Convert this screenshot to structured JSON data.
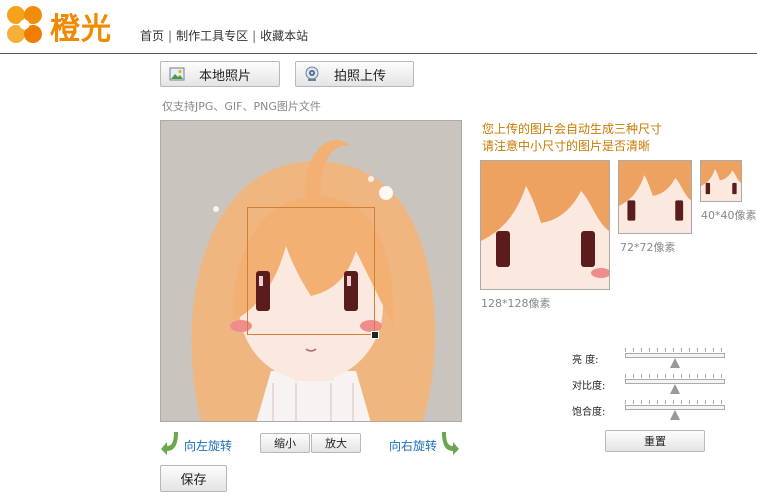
{
  "header": {
    "logo_text": "橙光",
    "nav": [
      "首页",
      "制作工具专区",
      "收藏本站"
    ]
  },
  "upload": {
    "local_photo_label": "本地照片",
    "camera_upload_label": "拍照上传",
    "format_hint": "仅支持JPG、GIF、PNG图片文件"
  },
  "preview": {
    "notice_line1": "您上传的图片会自动生成三种尺寸",
    "notice_line2": "请注意中小尺寸的图片是否清晰",
    "size_large": "128*128像素",
    "size_medium": "72*72像素",
    "size_small": "40*40像素"
  },
  "adjust": {
    "brightness_label": "亮 度:",
    "contrast_label": "对比度:",
    "saturation_label": "饱合度:",
    "brightness": 0.5,
    "contrast": 0.5,
    "saturation": 0.5,
    "reset_label": "重置"
  },
  "controls": {
    "rotate_left": "向左旋转",
    "shrink": "缩小",
    "enlarge": "放大",
    "rotate_right": "向右旋转",
    "save": "保存"
  },
  "colors": {
    "accent_orange": "#f18a00",
    "notice_orange": "#c77a00",
    "link_blue": "#1a6fb5",
    "arrow_green": "#6aa84f"
  }
}
